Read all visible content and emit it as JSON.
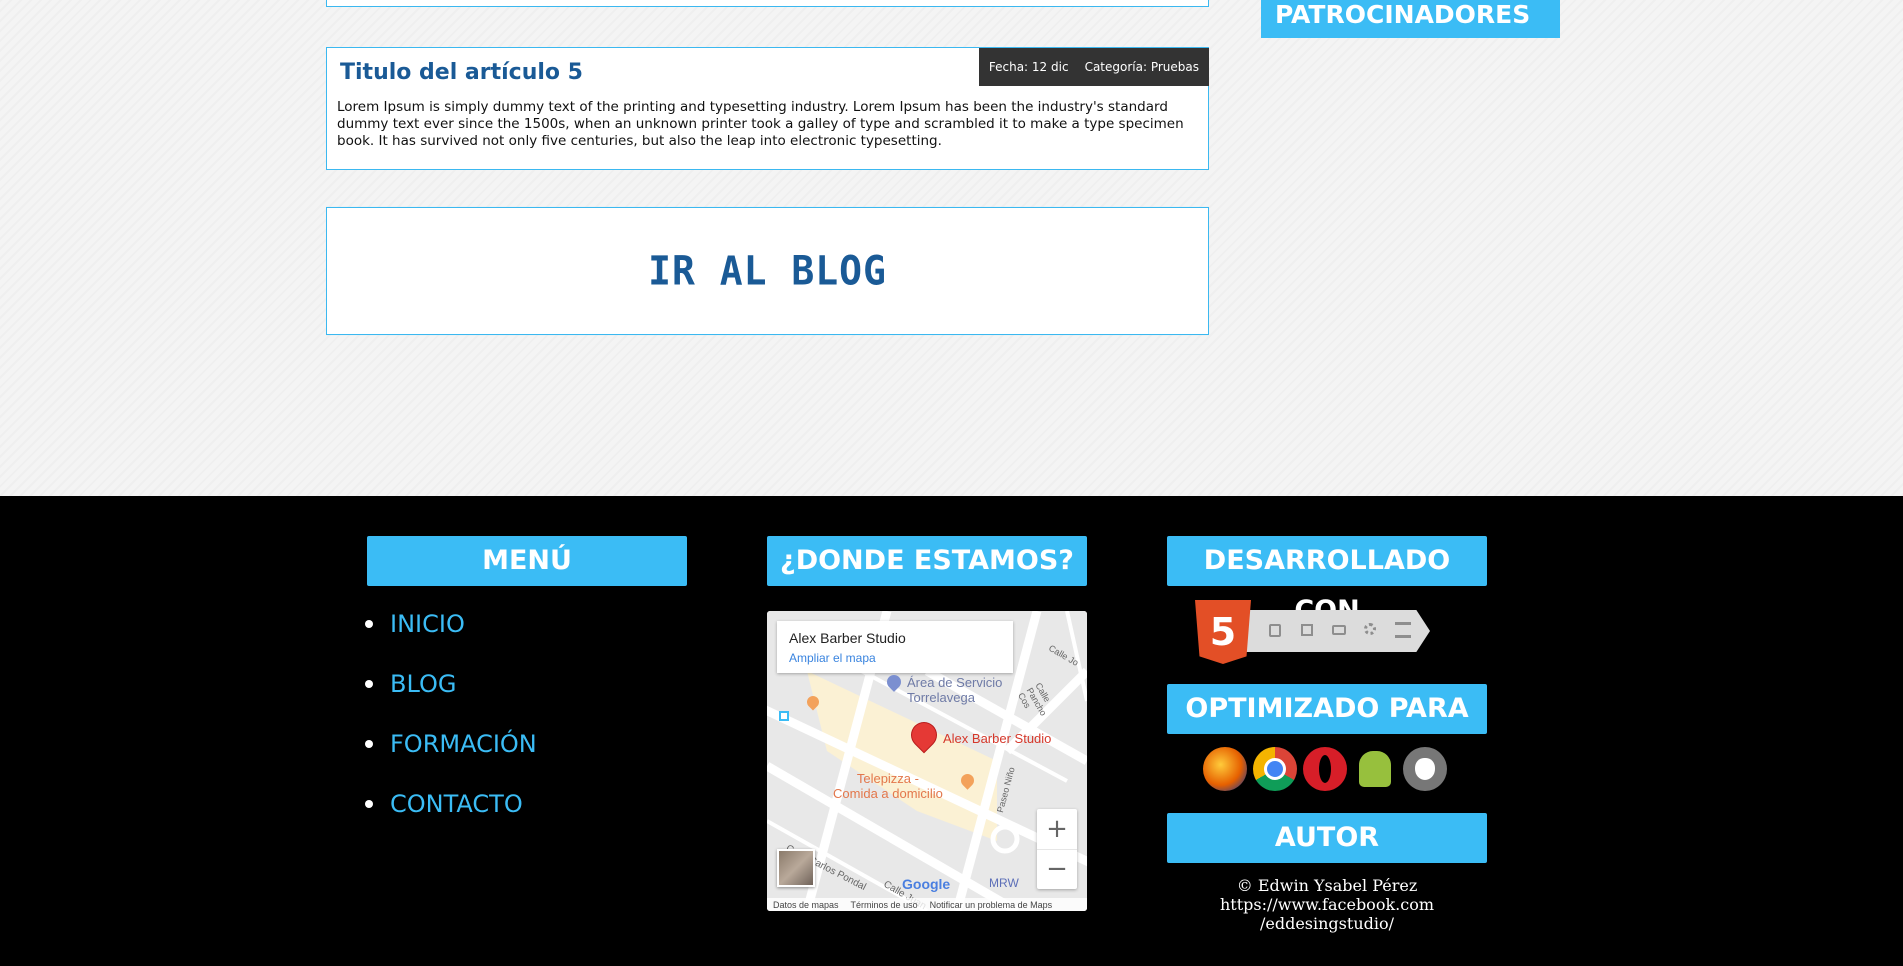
{
  "sidebar": {
    "sponsors_title": "PATROCINADORES"
  },
  "article": {
    "title": "Titulo del artículo 5",
    "date": "Fecha: 12 dic",
    "category": "Categoría: Pruebas",
    "body": "Lorem Ipsum is simply dummy text of the printing and typesetting industry. Lorem Ipsum has been the industry's standard dummy text ever since the 1500s, when an unknown printer took a galley of type and scrambled it to make a type specimen book. It has survived not only five centuries, but also the leap into electronic typesetting."
  },
  "blog_button": {
    "label": "IR AL BLOG"
  },
  "footer": {
    "menu": {
      "title": "MENÚ",
      "items": [
        {
          "label": "INICIO"
        },
        {
          "label": "BLOG"
        },
        {
          "label": "FORMACIÓN"
        },
        {
          "label": "CONTACTO"
        }
      ]
    },
    "location": {
      "title": "¿DONDE ESTAMOS?",
      "map": {
        "place_name": "Alex Barber Studio",
        "enlarge_link": "Ampliar el mapa",
        "label_service_area": "Área de Servicio",
        "label_city": "Torrelavega",
        "label_marker": "Alex Barber Studio",
        "label_restaurant_1": "Telepizza -",
        "label_restaurant_2": "Comida a domicilio",
        "label_street_1": "Calle Carlos Pondal",
        "label_street_2": "Calle Juan",
        "label_street_3": "Paseo Niño",
        "label_street_4": "Calle Pancho Cos",
        "label_street_5": "Calle Jo",
        "label_mrw": "MRW",
        "zoom_in": "+",
        "zoom_out": "−",
        "google": "Google",
        "attr_data": "Datos de mapas",
        "attr_terms": "Términos de uso",
        "attr_report": "Notificar un problema de Maps"
      }
    },
    "developed": {
      "title": "DESARROLLADO CON",
      "html5_badge": "5",
      "badge_icons": [
        "css-icon",
        "device-icon",
        "tablet-icon",
        "gear-icon",
        "layers-icon"
      ]
    },
    "optimized": {
      "title": "OPTIMIZADO PARA",
      "browsers": [
        "firefox-icon",
        "chrome-icon",
        "opera-icon",
        "android-icon",
        "apple-icon"
      ]
    },
    "author": {
      "title": "AUTOR",
      "line1": "© Edwin Ysabel Pérez",
      "line2": "https://www.facebook.com",
      "line3": "/eddesingstudio/"
    }
  },
  "colors": {
    "accent": "#3bbcf5",
    "title_blue": "#1a5a96",
    "footer_bg": "#000000",
    "meta_bg": "#333333"
  }
}
